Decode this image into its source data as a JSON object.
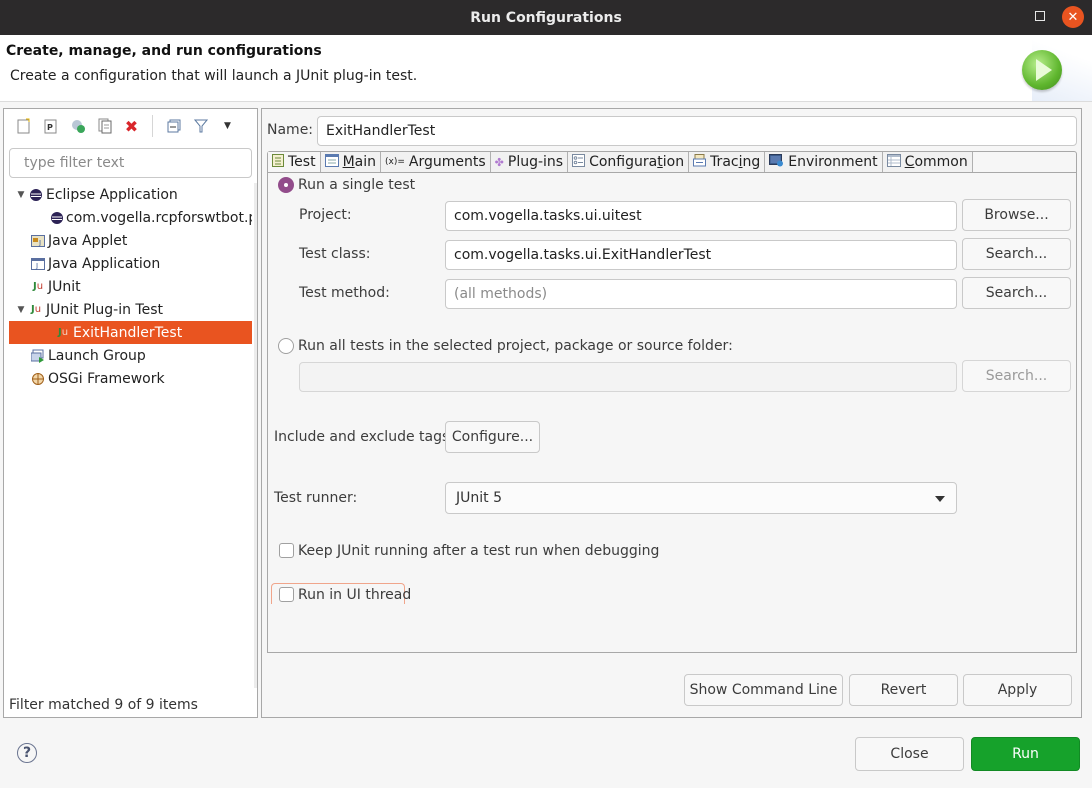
{
  "window": {
    "title": "Run Configurations",
    "maximize_icon": "maximize-icon",
    "close_icon": "close-icon"
  },
  "header": {
    "title": "Create, manage, and run configurations",
    "subtitle": "Create a configuration that will launch a JUnit plug-in test.",
    "graphic_icon": "run-launch-icon"
  },
  "left_toolbar": {
    "buttons": [
      {
        "name": "new-launch-configuration",
        "icon": "new-config-icon"
      },
      {
        "name": "new-prototype",
        "icon": "new-prototype-icon"
      },
      {
        "name": "export",
        "icon": "export-icon"
      },
      {
        "name": "duplicate",
        "icon": "duplicate-icon"
      },
      {
        "name": "delete",
        "icon": "delete-icon"
      },
      {
        "name": "collapse-all",
        "icon": "collapse-all-icon"
      },
      {
        "name": "filter",
        "icon": "filter-icon"
      },
      {
        "name": "view-menu",
        "icon": "chevron-down-icon"
      }
    ]
  },
  "filter": {
    "placeholder": "type filter text",
    "value": ""
  },
  "tree": {
    "items": [
      {
        "label": "Eclipse Application",
        "level": 0,
        "expanded": true,
        "icon": "eclipse-icon"
      },
      {
        "label": "com.vogella.rcpforswtbot.p",
        "level": 1,
        "icon": "eclipse-icon"
      },
      {
        "label": "Java Applet",
        "level": 0,
        "icon": "java-applet-icon"
      },
      {
        "label": "Java Application",
        "level": 0,
        "icon": "java-application-icon"
      },
      {
        "label": "JUnit",
        "level": 0,
        "icon": "junit-icon"
      },
      {
        "label": "JUnit Plug-in Test",
        "level": 0,
        "expanded": true,
        "icon": "junit-plugin-icon"
      },
      {
        "label": "ExitHandlerTest",
        "level": 1,
        "selected": true,
        "icon": "junit-plugin-icon"
      },
      {
        "label": "Launch Group",
        "level": 0,
        "icon": "launch-group-icon"
      },
      {
        "label": "OSGi Framework",
        "level": 0,
        "icon": "osgi-icon"
      }
    ],
    "status": "Filter matched 9 of 9 items"
  },
  "config": {
    "name_label": "Name:",
    "name_value": "ExitHandlerTest",
    "tabs": [
      {
        "label": "Test",
        "icon": "test-tab-icon",
        "active": true
      },
      {
        "label": "Main",
        "mnemonic": "M",
        "icon": "main-tab-icon"
      },
      {
        "label": "Arguments",
        "icon": "arguments-tab-icon"
      },
      {
        "label": "Plug-ins",
        "icon": "plugins-tab-icon"
      },
      {
        "label": "Configuration",
        "mnemonic": "t",
        "icon": "configuration-tab-icon"
      },
      {
        "label": "Tracing",
        "mnemonic": "i",
        "icon": "tracing-tab-icon"
      },
      {
        "label": "Environment",
        "icon": "environment-tab-icon"
      },
      {
        "label": "Common",
        "mnemonic": "C",
        "icon": "common-tab-icon"
      }
    ],
    "test_tab": {
      "run_single": {
        "label": "Run a single test",
        "checked": true
      },
      "project": {
        "label": "Project:",
        "value": "com.vogella.tasks.ui.uitest",
        "button": "Browse..."
      },
      "test_class": {
        "label": "Test class:",
        "value": "com.vogella.tasks.ui.ExitHandlerTest",
        "button": "Search..."
      },
      "test_method": {
        "label": "Test method:",
        "value": "",
        "placeholder": "(all methods)",
        "button": "Search..."
      },
      "run_all": {
        "label": "Run all tests in the selected project, package or source folder:",
        "checked": false,
        "value": "",
        "button": "Search..."
      },
      "tags": {
        "label": "Include and exclude tags:",
        "button": "Configure..."
      },
      "runner": {
        "label": "Test runner:",
        "value": "JUnit 5"
      },
      "keep_running": {
        "label": "Keep JUnit running after a test run when debugging",
        "checked": false
      },
      "ui_thread": {
        "label": "Run in UI thread",
        "checked": false
      }
    },
    "buttons": {
      "show_command_line": "Show Command Line",
      "revert": "Revert",
      "apply": "Apply"
    }
  },
  "footer": {
    "help_icon": "help-icon",
    "close": "Close",
    "run": "Run"
  },
  "colors": {
    "selection": "#e95420",
    "run_button": "#16a22b",
    "radio_checked": "#924d8b"
  }
}
